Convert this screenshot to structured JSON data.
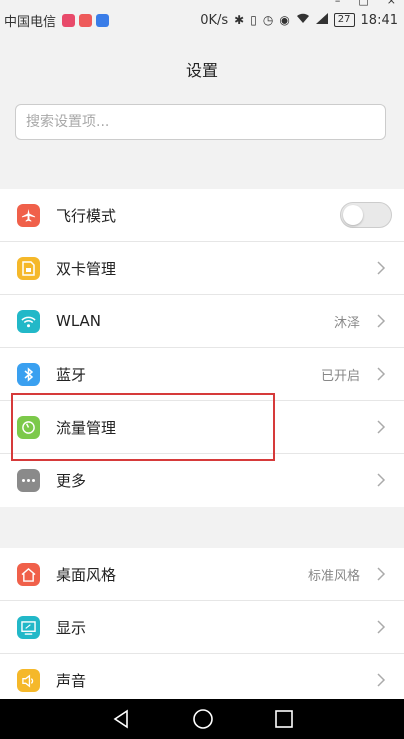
{
  "status_bar": {
    "carrier": "中国电信",
    "speed": "0K/s",
    "battery": "27",
    "time": "18:41",
    "app_icon_colors": [
      "#e84a6a",
      "#ee5a5a",
      "#3a7de8"
    ]
  },
  "window_controls": {
    "minimize": "–",
    "maximize": "□",
    "close": "×"
  },
  "header": {
    "title": "设置"
  },
  "search": {
    "placeholder": "搜索设置项..."
  },
  "group1": {
    "items": [
      {
        "label": "飞行模式",
        "icon": "airplane-icon",
        "color": "#f0604a",
        "toggle_on": false
      },
      {
        "label": "双卡管理",
        "icon": "sim-card-icon",
        "color": "#f5b82a"
      },
      {
        "label": "WLAN",
        "icon": "wifi-icon",
        "color": "#22b8c8",
        "value": "沐泽"
      },
      {
        "label": "蓝牙",
        "icon": "bluetooth-icon",
        "color": "#3aa0f0",
        "value": "已开启"
      },
      {
        "label": "流量管理",
        "icon": "data-usage-icon",
        "color": "#7cc94a"
      },
      {
        "label": "更多",
        "icon": "more-icon",
        "color": "#8a8a8a"
      }
    ]
  },
  "group2": {
    "items": [
      {
        "label": "桌面风格",
        "icon": "home-icon",
        "color": "#f0604a",
        "value": "标准风格"
      },
      {
        "label": "显示",
        "icon": "display-icon",
        "color": "#22b8c8"
      },
      {
        "label": "声音",
        "icon": "sound-icon",
        "color": "#f5b82a"
      }
    ]
  },
  "highlight_color": "#d63a3a"
}
